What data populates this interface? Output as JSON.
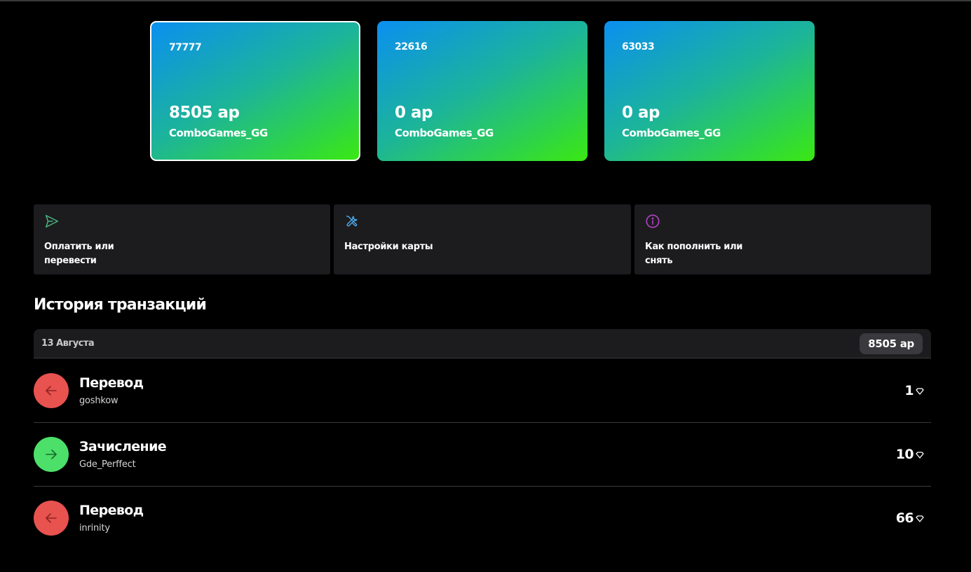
{
  "colors": {
    "background": "#000000",
    "panel": "#1c1c1f",
    "outgoing": "#e8524f",
    "incoming": "#4cdf69",
    "send_icon": "#49b882",
    "tools_icon": "#4da8e8",
    "info_icon": "#b43fc4"
  },
  "cards": [
    {
      "number": "77777",
      "balance": "8505 ар",
      "owner": "ComboGames_GG",
      "selected": true
    },
    {
      "number": "22616",
      "balance": "0 ар",
      "owner": "ComboGames_GG",
      "selected": false
    },
    {
      "number": "63033",
      "balance": "0 ар",
      "owner": "ComboGames_GG",
      "selected": false
    }
  ],
  "actions": [
    {
      "label": "Оплатить или перевести",
      "icon": "send-icon"
    },
    {
      "label": "Настройки карты",
      "icon": "tools-icon"
    },
    {
      "label": "Как пополнить или снять",
      "icon": "info-icon"
    }
  ],
  "history": {
    "title": "История транзакций",
    "date": "13 Августа",
    "day_total": "8505 ар",
    "transactions": [
      {
        "type": "Перевод",
        "user": "goshkow",
        "amount": "1",
        "direction": "outgoing"
      },
      {
        "type": "Зачисление",
        "user": "Gde_Perffect",
        "amount": "10",
        "direction": "incoming"
      },
      {
        "type": "Перевод",
        "user": "inrinity",
        "amount": "66",
        "direction": "outgoing"
      }
    ]
  }
}
